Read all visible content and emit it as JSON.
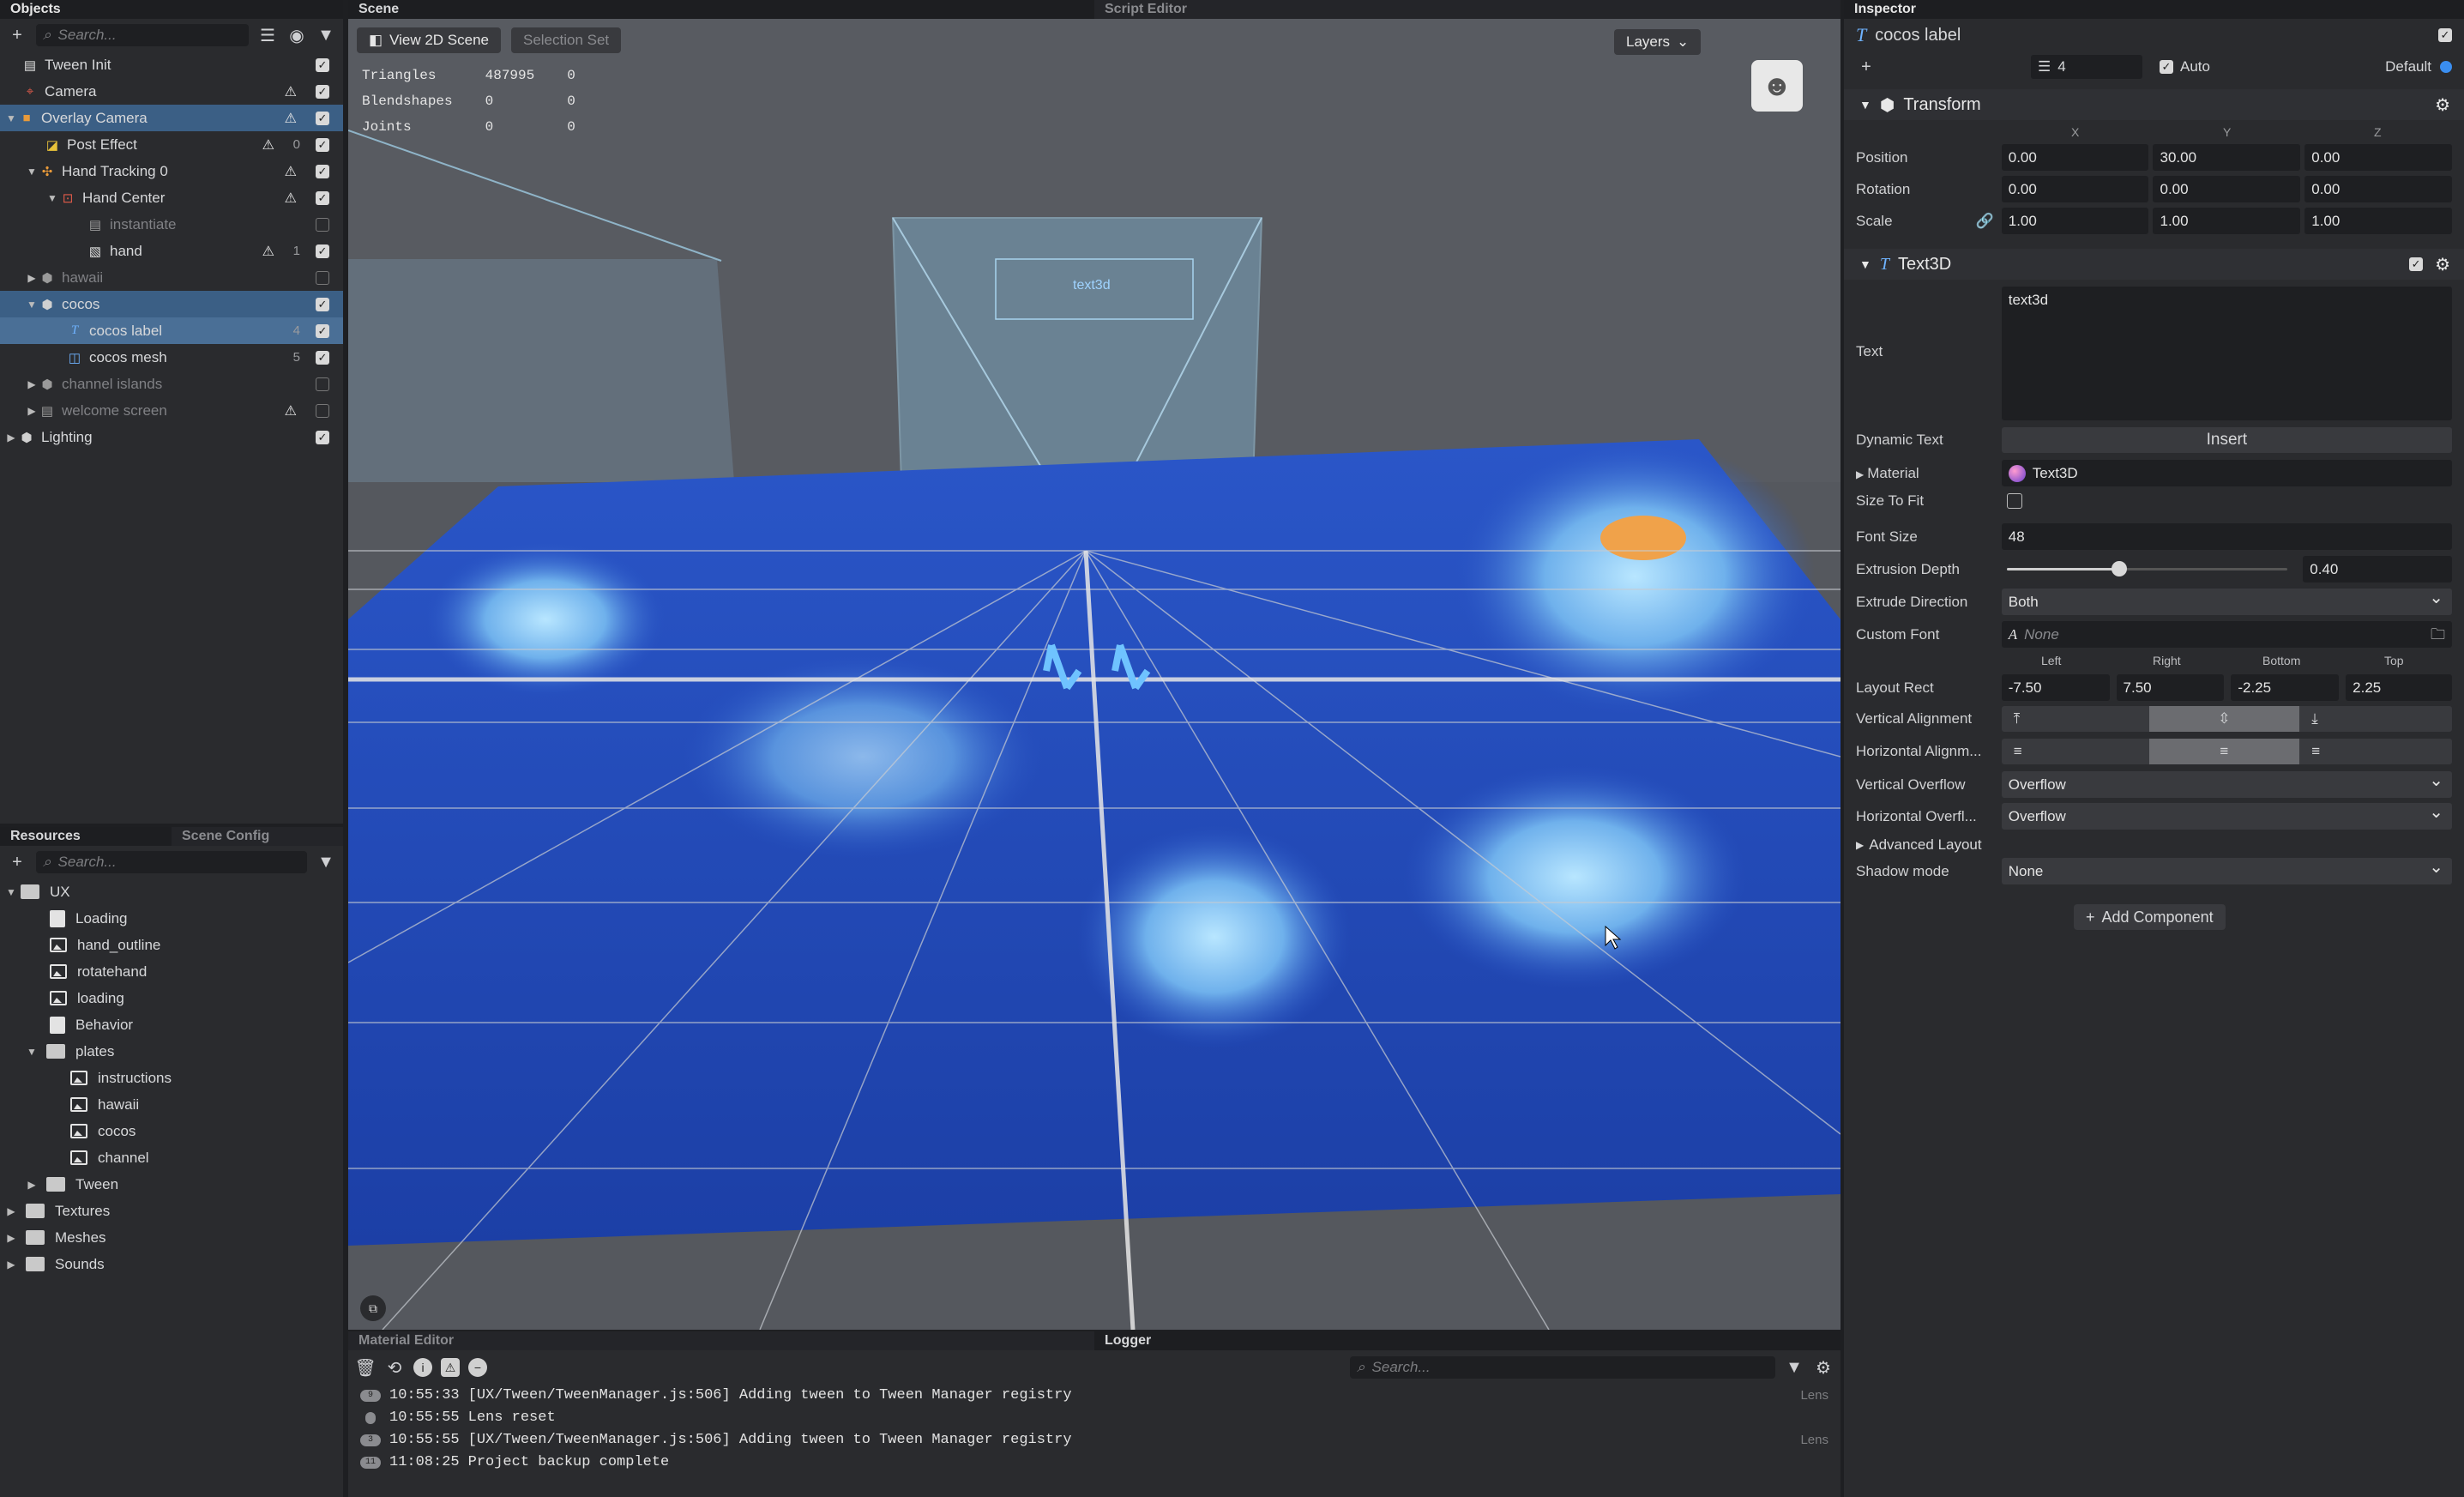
{
  "objects": {
    "title": "Objects",
    "search_placeholder": "Search...",
    "items": [
      {
        "label": "Tween Init",
        "num": ""
      },
      {
        "label": "Camera",
        "num": ""
      },
      {
        "label": "Overlay Camera",
        "num": ""
      },
      {
        "label": "Post Effect",
        "num": "0"
      },
      {
        "label": "Hand Tracking 0",
        "num": ""
      },
      {
        "label": "Hand Center",
        "num": ""
      },
      {
        "label": "instantiate",
        "num": ""
      },
      {
        "label": "hand",
        "num": "1"
      },
      {
        "label": "hawaii",
        "num": ""
      },
      {
        "label": "cocos",
        "num": ""
      },
      {
        "label": "cocos label",
        "num": "4"
      },
      {
        "label": "cocos mesh",
        "num": "5"
      },
      {
        "label": "channel islands",
        "num": ""
      },
      {
        "label": "welcome screen",
        "num": ""
      },
      {
        "label": "Lighting",
        "num": ""
      }
    ]
  },
  "resources": {
    "tabs": [
      "Resources",
      "Scene Config"
    ],
    "search_placeholder": "Search...",
    "items": [
      "UX",
      "Loading",
      "hand_outline",
      "rotatehand",
      "loading",
      "Behavior",
      "plates",
      "instructions",
      "hawaii",
      "cocos",
      "channel",
      "Tween",
      "Textures",
      "Meshes",
      "Sounds"
    ]
  },
  "scene": {
    "tabs": [
      "Scene",
      "Script Editor"
    ],
    "view_2d_label": "View 2D Scene",
    "selection_set_label": "Selection Set",
    "layers_label": "Layers",
    "stats": [
      {
        "name": "Triangles",
        "a": "487995",
        "b": "0"
      },
      {
        "name": "Blendshapes",
        "a": "0",
        "b": "0"
      },
      {
        "name": "Joints",
        "a": "0",
        "b": "0"
      }
    ],
    "text_preview": "text3d"
  },
  "bottom": {
    "tabs": [
      "Material Editor",
      "Logger"
    ],
    "search_placeholder": "Search...",
    "logs": [
      {
        "badge": "9",
        "time": "10:55:33",
        "msg": "[UX/Tween/TweenManager.js:506] Adding tween  to Tween Manager registry",
        "src": "Lens"
      },
      {
        "badge": "",
        "time": "10:55:55",
        "msg": "Lens reset",
        "src": ""
      },
      {
        "badge": "3",
        "time": "10:55:55",
        "msg": "[UX/Tween/TweenManager.js:506] Adding tween  to Tween Manager registry",
        "src": "Lens"
      },
      {
        "badge": "11",
        "time": "11:08:25",
        "msg": "Project backup complete",
        "src": ""
      }
    ]
  },
  "inspector": {
    "title": "Inspector",
    "object_name": "cocos label",
    "layer_num": "4",
    "auto_label": "Auto",
    "default_label": "Default",
    "transform": {
      "title": "Transform",
      "axes": [
        "X",
        "Y",
        "Z"
      ],
      "position_label": "Position",
      "position": [
        "0.00",
        "30.00",
        "0.00"
      ],
      "rotation_label": "Rotation",
      "rotation": [
        "0.00",
        "0.00",
        "0.00"
      ],
      "scale_label": "Scale",
      "scale": [
        "1.00",
        "1.00",
        "1.00"
      ]
    },
    "text3d": {
      "title": "Text3D",
      "text_label": "Text",
      "text_value": "text3d",
      "dynamic_text_label": "Dynamic Text",
      "insert_label": "Insert",
      "material_label": "Material",
      "material_value": "Text3D",
      "size_to_fit_label": "Size To Fit",
      "font_size_label": "Font Size",
      "font_size": "48",
      "extrusion_label": "Extrusion Depth",
      "extrusion_value": "0.40",
      "extrusion_slider": 0.4,
      "extrude_dir_label": "Extrude Direction",
      "extrude_dir": "Both",
      "custom_font_label": "Custom Font",
      "custom_font": "None",
      "rect_cols": [
        "Left",
        "Right",
        "Bottom",
        "Top"
      ],
      "layout_rect_label": "Layout Rect",
      "layout_rect": [
        "-7.50",
        "7.50",
        "-2.25",
        "2.25"
      ],
      "valign_label": "Vertical Alignment",
      "halign_label": "Horizontal Alignm...",
      "voverflow_label": "Vertical Overflow",
      "voverflow": "Overflow",
      "hoverflow_label": "Horizontal Overfl...",
      "hoverflow": "Overflow",
      "advanced_label": "Advanced Layout",
      "shadow_label": "Shadow mode",
      "shadow": "None"
    },
    "add_component_label": "Add Component"
  }
}
